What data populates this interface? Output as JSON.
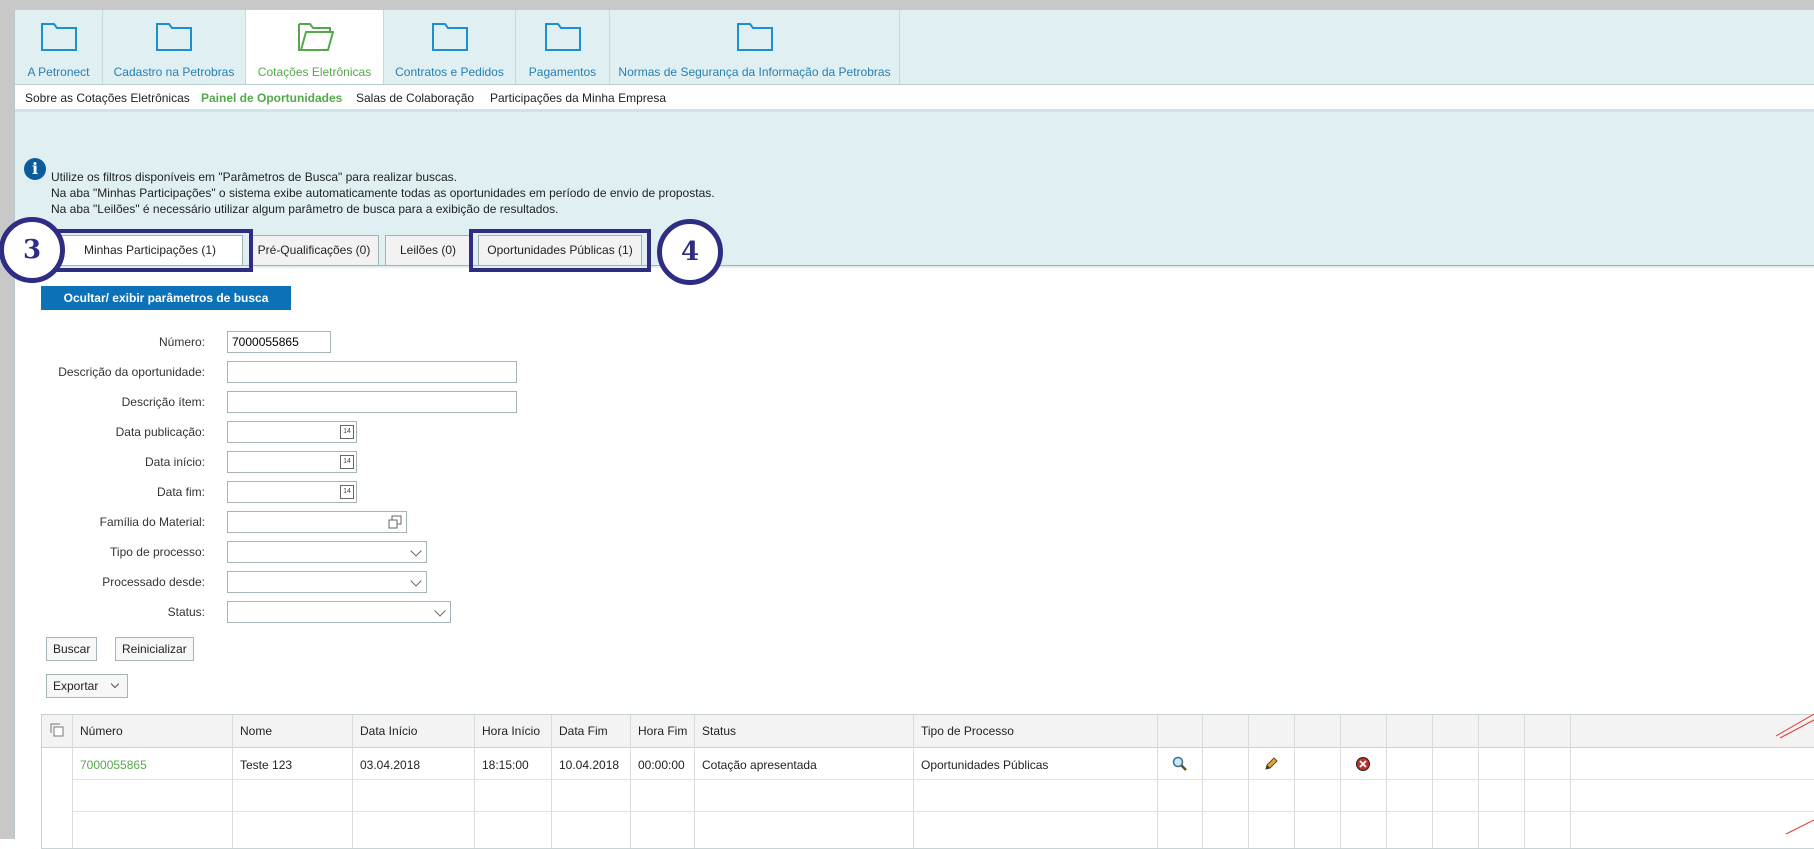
{
  "nav": {
    "tabs": [
      {
        "label": "A Petronect"
      },
      {
        "label": "Cadastro na Petrobras"
      },
      {
        "label": "Cotações Eletrônicas"
      },
      {
        "label": "Contratos e Pedidos"
      },
      {
        "label": "Pagamentos"
      },
      {
        "label": "Normas de Segurança da Informação da Petrobras"
      }
    ],
    "active_index": 2
  },
  "subnav": {
    "items": [
      {
        "label": "Sobre as Cotações Eletrônicas"
      },
      {
        "label": "Painel de Oportunidades"
      },
      {
        "label": "Salas de Colaboração"
      },
      {
        "label": "Participações da Minha Empresa"
      }
    ]
  },
  "info": {
    "lines": [
      "Utilize os filtros disponíveis em \"Parâmetros de Busca\" para realizar buscas.",
      "Na aba \"Minhas Participações\" o sistema exibe automaticamente todas as oportunidades em período de envio de propostas.",
      "Na aba \"Leilões\" é necessário utilizar algum parâmetro de busca para a exibição de resultados."
    ]
  },
  "tabs": [
    {
      "label": "Minhas Participações (1)"
    },
    {
      "label": "Pré-Qualificações (0)"
    },
    {
      "label": "Leilões (0)"
    },
    {
      "label": "Oportunidades Públicas (1)"
    }
  ],
  "callouts": {
    "left": "3",
    "right": "4"
  },
  "search": {
    "toggle_label": "Ocultar/ exibir parâmetros de busca",
    "fields": {
      "numero": {
        "label": "Número:",
        "value": "7000055865"
      },
      "descricao_oportunidade": {
        "label": "Descrição da oportunidade:",
        "value": ""
      },
      "descricao_item": {
        "label": "Descrição ítem:",
        "value": ""
      },
      "data_publicacao": {
        "label": "Data publicação:",
        "value": ""
      },
      "data_inicio": {
        "label": "Data início:",
        "value": ""
      },
      "data_fim": {
        "label": "Data fim:",
        "value": ""
      },
      "familia_material": {
        "label": "Família do Material:",
        "value": ""
      },
      "tipo_processo": {
        "label": "Tipo de processo:",
        "value": ""
      },
      "processado_desde": {
        "label": "Processado desde:",
        "value": ""
      },
      "status": {
        "label": "Status:",
        "value": ""
      }
    },
    "calendar_glyph": "14",
    "buscar_label": "Buscar",
    "reinicializar_label": "Reinicializar",
    "exportar_label": "Exportar"
  },
  "table": {
    "columns": [
      "Número",
      "Nome",
      "Data Início",
      "Hora Início",
      "Data Fim",
      "Hora Fim",
      "Status",
      "Tipo de Processo"
    ],
    "rows": [
      {
        "numero": "7000055865",
        "nome": "Teste 123",
        "data_inicio": "03.04.2018",
        "hora_inicio": "18:15:00",
        "data_fim": "10.04.2018",
        "hora_fim": "00:00:00",
        "status": "Cotação apresentada",
        "tipo": "Oportunidades Públicas",
        "actions": [
          "magnifier-icon",
          "pencil-icon",
          "cancel-icon"
        ]
      }
    ]
  },
  "colors": {
    "accent_blue": "#0b72b8",
    "active_green": "#55a84a",
    "callout": "#2e2d83",
    "band": "#dfeff2"
  }
}
